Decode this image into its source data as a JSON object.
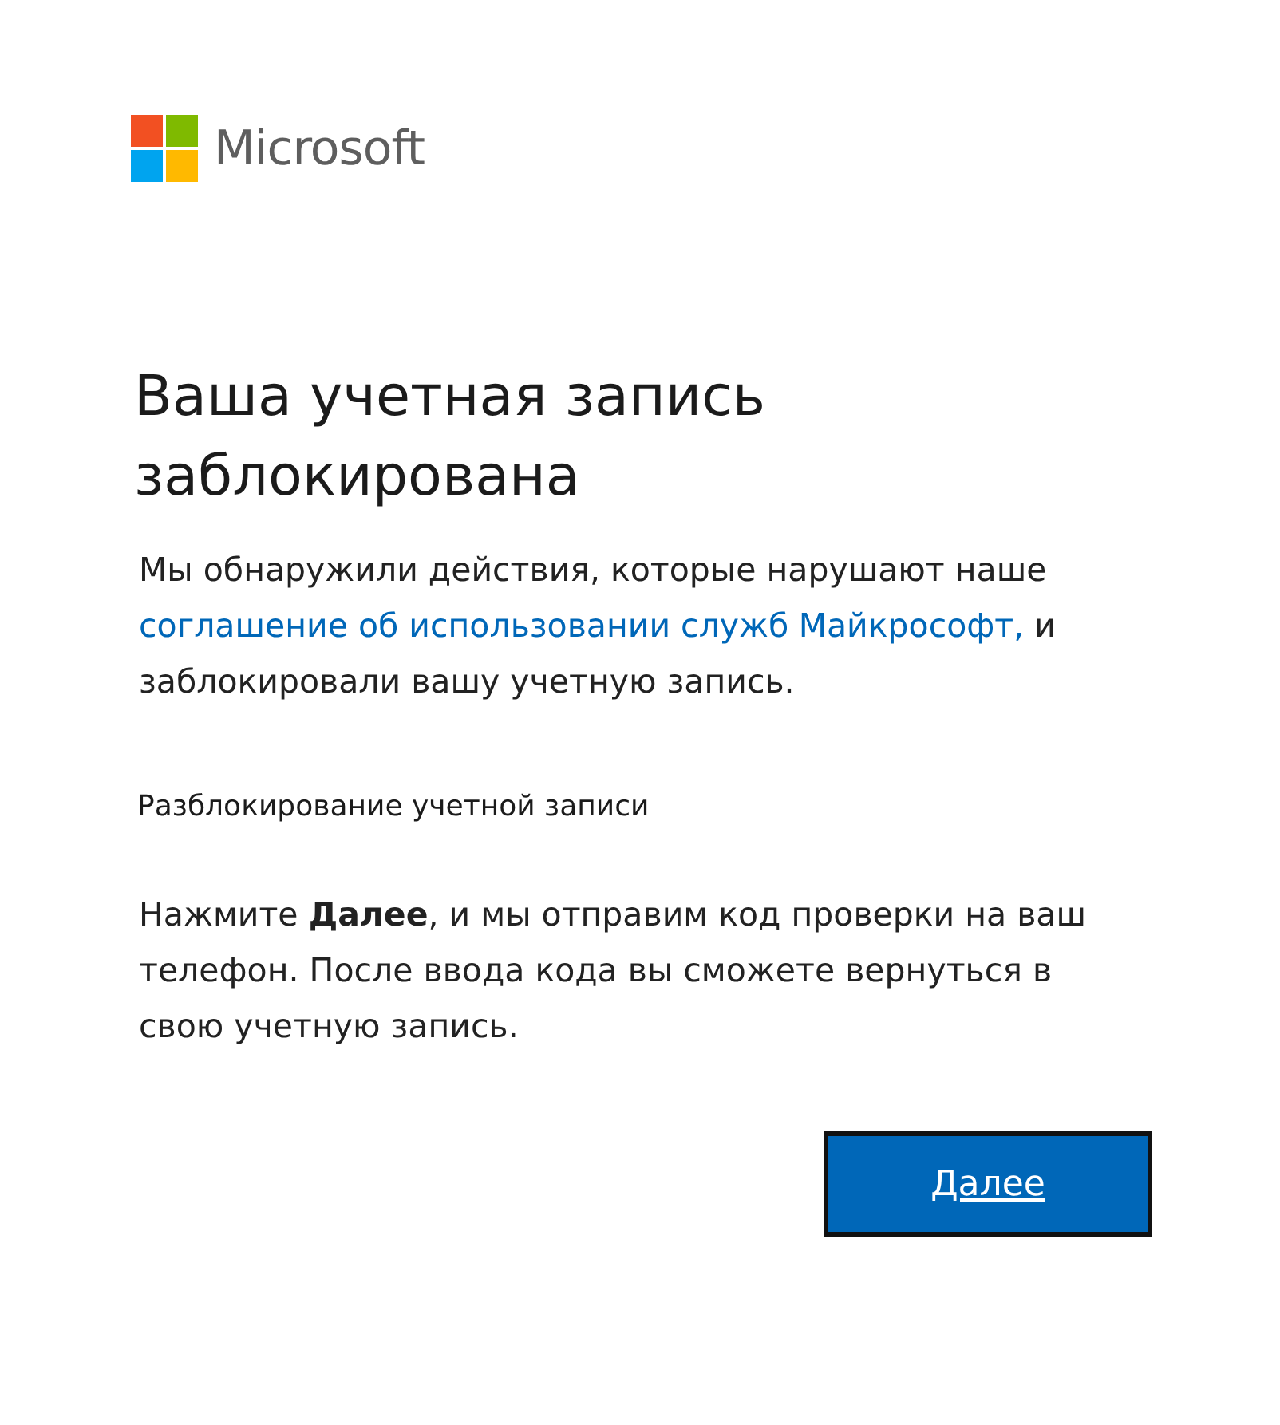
{
  "logo": {
    "text": "Microsoft"
  },
  "title": "Ваша учетная запись заблокирована",
  "message": [
    {
      "kind": "text",
      "text": "Мы обнаружили действия, которые нарушают наше "
    },
    {
      "kind": "link",
      "text": "соглашение об использовании служб"
    },
    {
      "kind": "link",
      "text": "Майкрософт,"
    },
    {
      "kind": "text",
      "text": " и заблокировали вашу учетную запись."
    }
  ],
  "section_title": "Разблокирование учетной записи",
  "instructions": "Нажмите **Далее**, и мы отправим код проверки на ваш телефон. После ввода кода вы сможете вернуться в свою учетную запись.",
  "next_button": "Далее"
}
